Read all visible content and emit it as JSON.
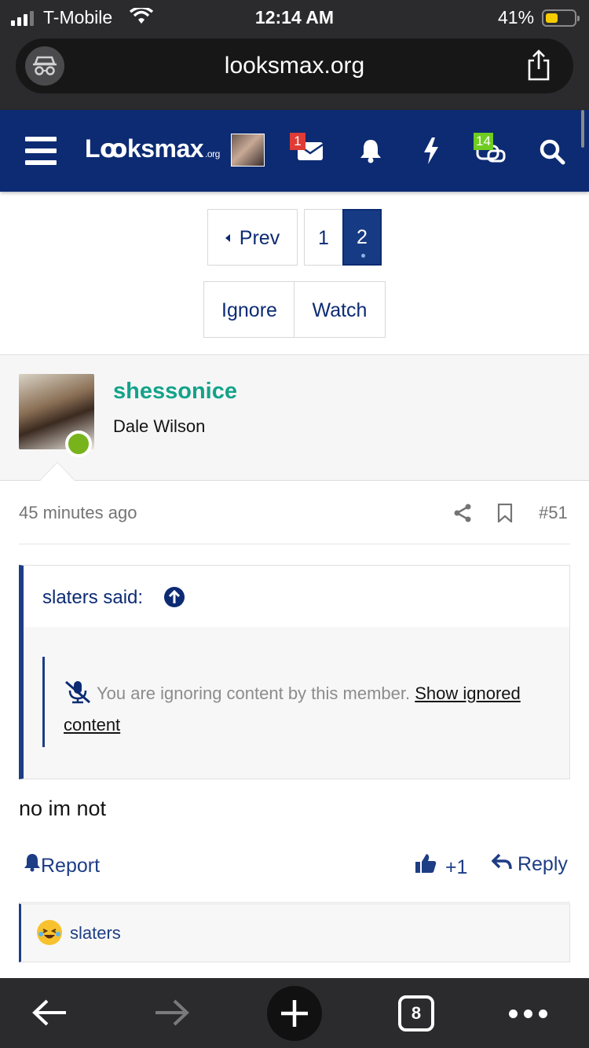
{
  "status_bar": {
    "carrier": "T-Mobile",
    "time": "12:14 AM",
    "battery_percent": "41%",
    "battery_level": 0.41
  },
  "browser": {
    "url": "looksmax.org",
    "open_tabs": "8"
  },
  "site_header": {
    "logo_text": "Lꝏksmax",
    "logo_suffix": ".org",
    "inbox_badge": "1",
    "conversations_badge": "14"
  },
  "pagination": {
    "prev_label": "Prev",
    "pages": [
      "1",
      "2"
    ],
    "current_page": "2"
  },
  "thread_actions": {
    "ignore_label": "Ignore",
    "watch_label": "Watch"
  },
  "post": {
    "username": "shessonice",
    "user_title": "Dale Wilson",
    "time_ago": "45 minutes ago",
    "post_number": "#51",
    "quote": {
      "author_said": "slaters said:",
      "ignored_message": "You are ignoring content by this member.",
      "show_ignored_link": "Show ignored content"
    },
    "body": "no im not",
    "report_label": "Report",
    "like_count": "+1",
    "reply_label": "Reply",
    "reactions_by": "slaters"
  },
  "colors": {
    "header_bg": "#0c2b73",
    "accent_blue": "#1d3d85",
    "username_green": "#13a38a",
    "online_green": "#78b31c",
    "badge_red": "#e03b35",
    "badge_green": "#6fcc21"
  }
}
